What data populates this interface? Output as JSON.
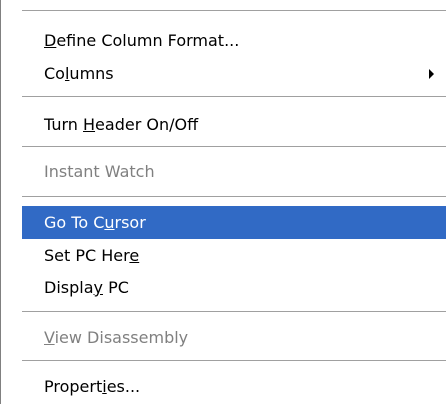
{
  "menu": {
    "items": [
      {
        "pre": "",
        "key": "D",
        "post": "efine Column Format..."
      },
      {
        "pre": "Co",
        "key": "l",
        "post": "umns"
      },
      {
        "pre": "Turn ",
        "key": "H",
        "post": "eader On/Off"
      },
      {
        "pre": "Instant Watch",
        "key": "",
        "post": ""
      },
      {
        "pre": "Go To C",
        "key": "u",
        "post": "rsor"
      },
      {
        "pre": "Set PC Her",
        "key": "e",
        "post": ""
      },
      {
        "pre": "Displa",
        "key": "y",
        "post": " PC"
      },
      {
        "pre": "",
        "key": "V",
        "post": "iew Disassembly"
      },
      {
        "pre": "Propert",
        "key": "i",
        "post": "es..."
      }
    ],
    "submenu_arrow_icon": "triangle-right",
    "highlight_color": "#316ac5"
  }
}
